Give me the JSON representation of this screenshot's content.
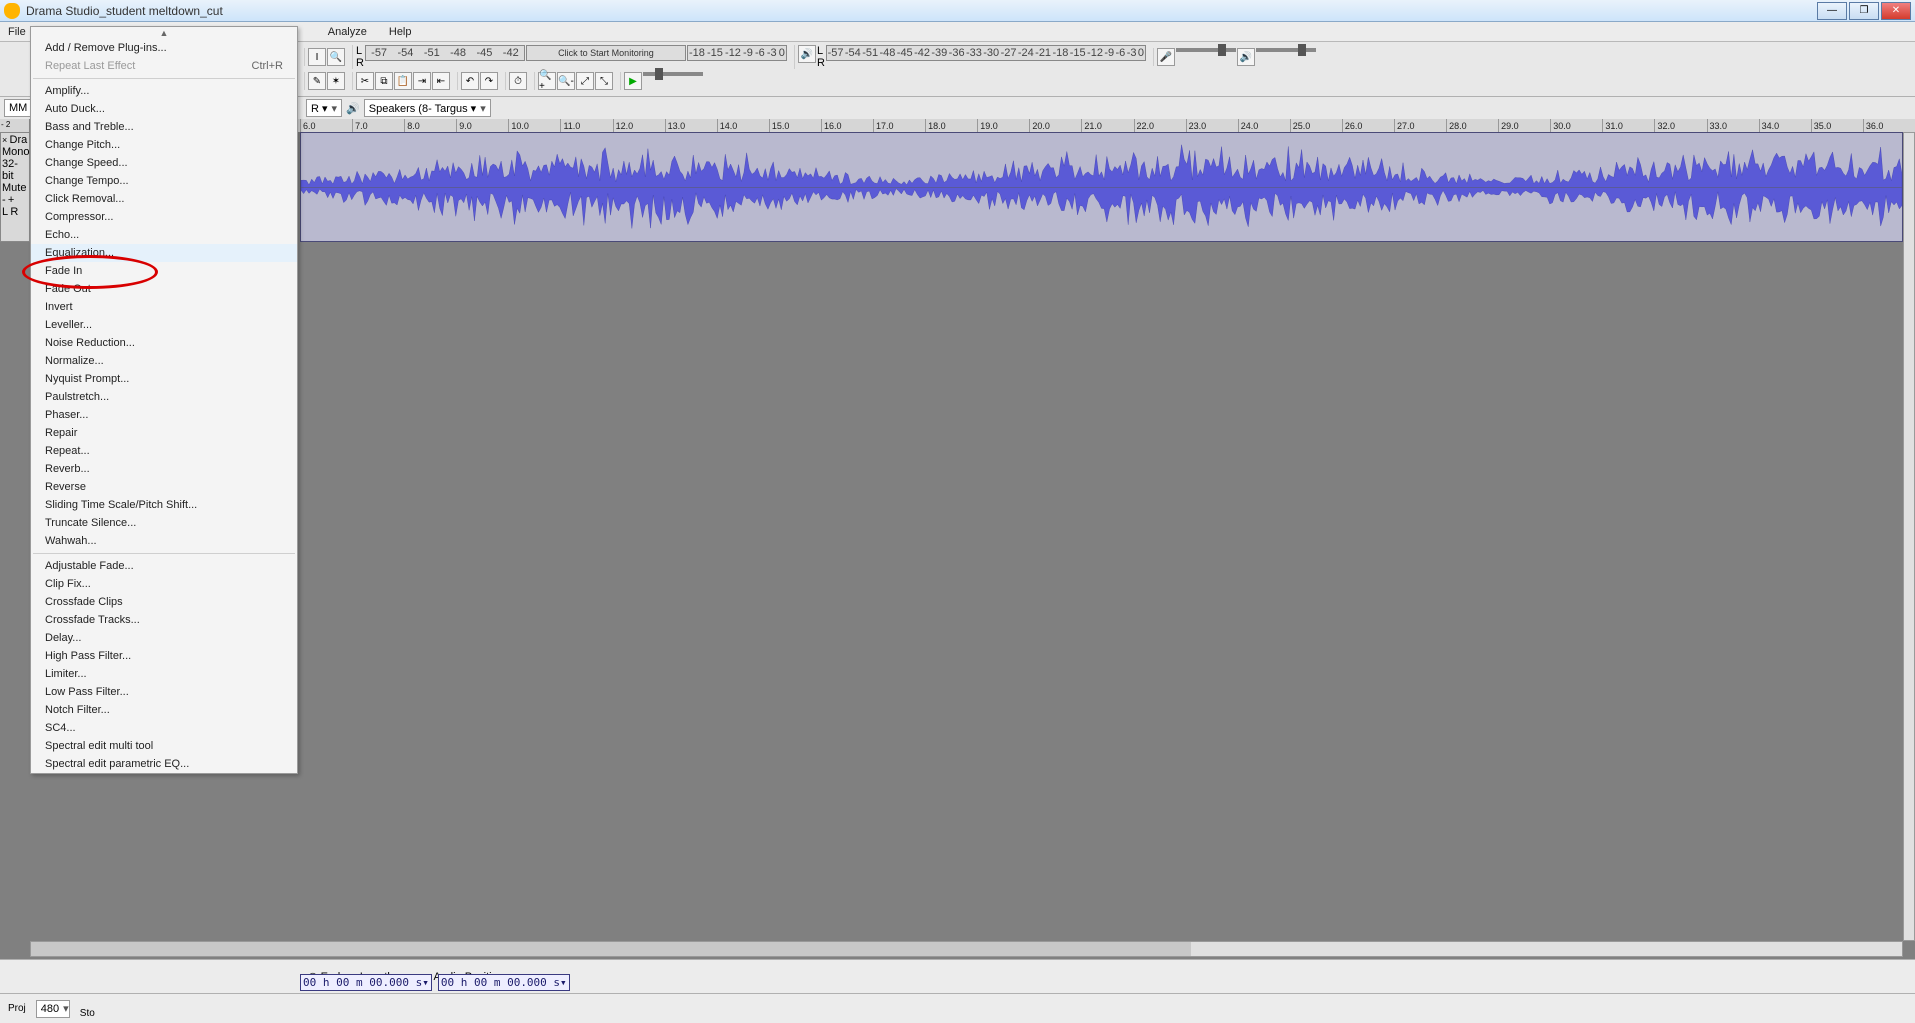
{
  "window": {
    "title": "Drama Studio_student meltdown_cut",
    "min": "—",
    "max": "❐",
    "close": "✕"
  },
  "menu": {
    "file": "File",
    "analyze": "Analyze",
    "help": "Help"
  },
  "toolbar": {
    "monitor_text_L": "L",
    "monitor_text_R": "R",
    "monitor_click": "Click to Start Monitoring",
    "rec_ticks": [
      "-57",
      "-54",
      "-51",
      "-48",
      "-45",
      "-42"
    ],
    "play_ticks": [
      "-57",
      "-54",
      "-51",
      "-48",
      "-45",
      "-42",
      "-39",
      "-36",
      "-33",
      "-30",
      "-27",
      "-24",
      "-21",
      "-18",
      "-15",
      "-12",
      "-9",
      "-6",
      "-3",
      "0"
    ],
    "rec_ticks2": [
      "-18",
      "-15",
      "-12",
      "-9",
      "-6",
      "-3",
      "0"
    ]
  },
  "devices": {
    "host": "MM",
    "rec_dev": "R ▾",
    "speaker_icon": "🔊",
    "out_dev": "Speakers (8- Targus ▾"
  },
  "ruler": {
    "start_neg": "- 2",
    "labels": [
      "6.0",
      "7.0",
      "8.0",
      "9.0",
      "10.0",
      "11.0",
      "12.0",
      "13.0",
      "14.0",
      "15.0",
      "16.0",
      "17.0",
      "18.0",
      "19.0",
      "20.0",
      "21.0",
      "22.0",
      "23.0",
      "24.0",
      "25.0",
      "26.0",
      "27.0",
      "28.0",
      "29.0",
      "30.0",
      "31.0",
      "32.0",
      "33.0",
      "34.0",
      "35.0",
      "36.0"
    ]
  },
  "track": {
    "close": "×",
    "name": "Dra",
    "info1": "Mono,",
    "info2": "32-bit",
    "mute": "Mute",
    "gain_minus": "-",
    "gain_plus": "+",
    "pan_l": "L",
    "pan_r": "R"
  },
  "selection": {
    "end_label": "End",
    "length_label": "Length",
    "audio_pos_label": "Audio Position:",
    "time1": "00 h 00 m 00.000 s▾",
    "time2": "00 h 00 m 00.000 s▾"
  },
  "status": {
    "proj_label": "Proj",
    "proj_val": "480",
    "sto_label": "Sto"
  },
  "effects_menu": {
    "top": [
      {
        "label": "Add / Remove Plug-ins...",
        "enabled": true
      },
      {
        "label": "Repeat Last Effect",
        "shortcut": "Ctrl+R",
        "enabled": false
      }
    ],
    "group1": [
      "Amplify...",
      "Auto Duck...",
      "Bass and Treble...",
      "Change Pitch...",
      "Change Speed...",
      "Change Tempo...",
      "Click Removal...",
      "Compressor...",
      "Echo...",
      "Equalization...",
      "Fade In",
      "Fade Out",
      "Invert",
      "Leveller...",
      "Noise Reduction...",
      "Normalize...",
      "Nyquist Prompt...",
      "Paulstretch...",
      "Phaser...",
      "Repair",
      "Repeat...",
      "Reverb...",
      "Reverse",
      "Sliding Time Scale/Pitch Shift...",
      "Truncate Silence...",
      "Wahwah..."
    ],
    "group2": [
      "Adjustable Fade...",
      "Clip Fix...",
      "Crossfade Clips",
      "Crossfade Tracks...",
      "Delay...",
      "High Pass Filter...",
      "Limiter...",
      "Low Pass Filter...",
      "Notch Filter...",
      "SC4...",
      "Spectral edit multi tool",
      "Spectral edit parametric EQ..."
    ],
    "highlighted_index": 9
  },
  "annotation": {
    "target": "Equalization..."
  }
}
